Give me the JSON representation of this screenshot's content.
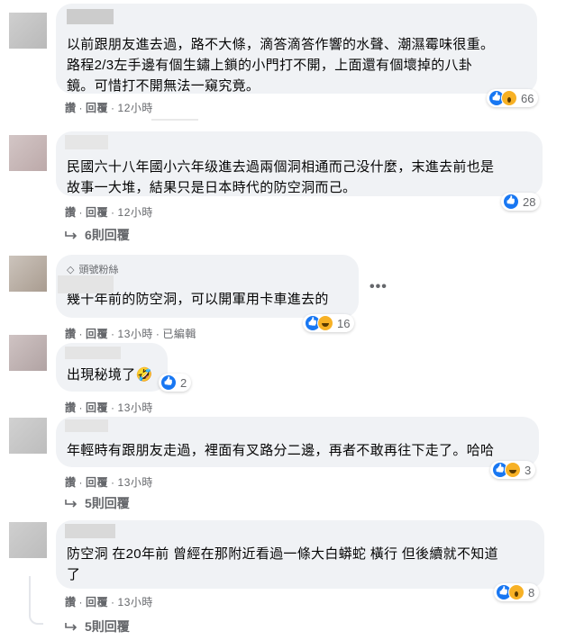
{
  "comments": [
    {
      "text": "以前跟朋友進去過，路不大條，滴答滴答作響的水聲、潮濕霉味很重。\n路程2/3左手邊有個生鏽上鎖的小門打不開，上面還有個壞掉的八卦\n鏡。可惜打不開無法一窺究竟。",
      "actions": {
        "like": "讚",
        "reply": "回覆",
        "time": "12小時"
      },
      "reaction_count": "66",
      "reaction_icons": [
        "like-icon",
        "wow-icon"
      ]
    },
    {
      "text": "民國六十八年國小六年级進去過兩個洞相通而己没什麼，末進去前也是\n故事一大堆，結果只是日本時代的防空洞而己。",
      "actions": {
        "like": "讚",
        "reply": "回覆",
        "time": "12小時"
      },
      "reaction_count": "28",
      "reaction_icons": [
        "like-icon"
      ],
      "replies_label": "6則回覆"
    },
    {
      "badge": "頭號粉絲",
      "text": "幾十年前的防空洞，可以開軍用卡車進去的",
      "actions": {
        "like": "讚",
        "reply": "回覆",
        "time": "13小時",
        "edited": "已編輯"
      },
      "reaction_count": "16",
      "reaction_icons": [
        "like-icon",
        "haha-icon"
      ]
    },
    {
      "text": "出現秘境了🤣",
      "actions": {
        "like": "讚",
        "reply": "回覆",
        "time": "13小時"
      },
      "reaction_count": "2",
      "reaction_icons": [
        "like-icon"
      ]
    },
    {
      "text": "年輕時有跟朋友走過，裡面有叉路分二邊，再者不敢再往下走了。哈哈",
      "actions": {
        "like": "讚",
        "reply": "回覆",
        "time": "13小時"
      },
      "reaction_count": "3",
      "reaction_icons": [
        "like-icon",
        "haha-icon"
      ],
      "replies_label": "5則回覆"
    },
    {
      "text": "防空洞 在20年前 曾經在那附近看過一條大白蟒蛇 橫行 但後續就不知道\n了",
      "actions": {
        "like": "讚",
        "reply": "回覆",
        "time": "13小時"
      },
      "reaction_count": "8",
      "reaction_icons": [
        "like-icon",
        "wow-icon"
      ],
      "replies_label": "5則回覆"
    }
  ],
  "more_icon": "more-horizontal-icon",
  "more_text": "•••"
}
